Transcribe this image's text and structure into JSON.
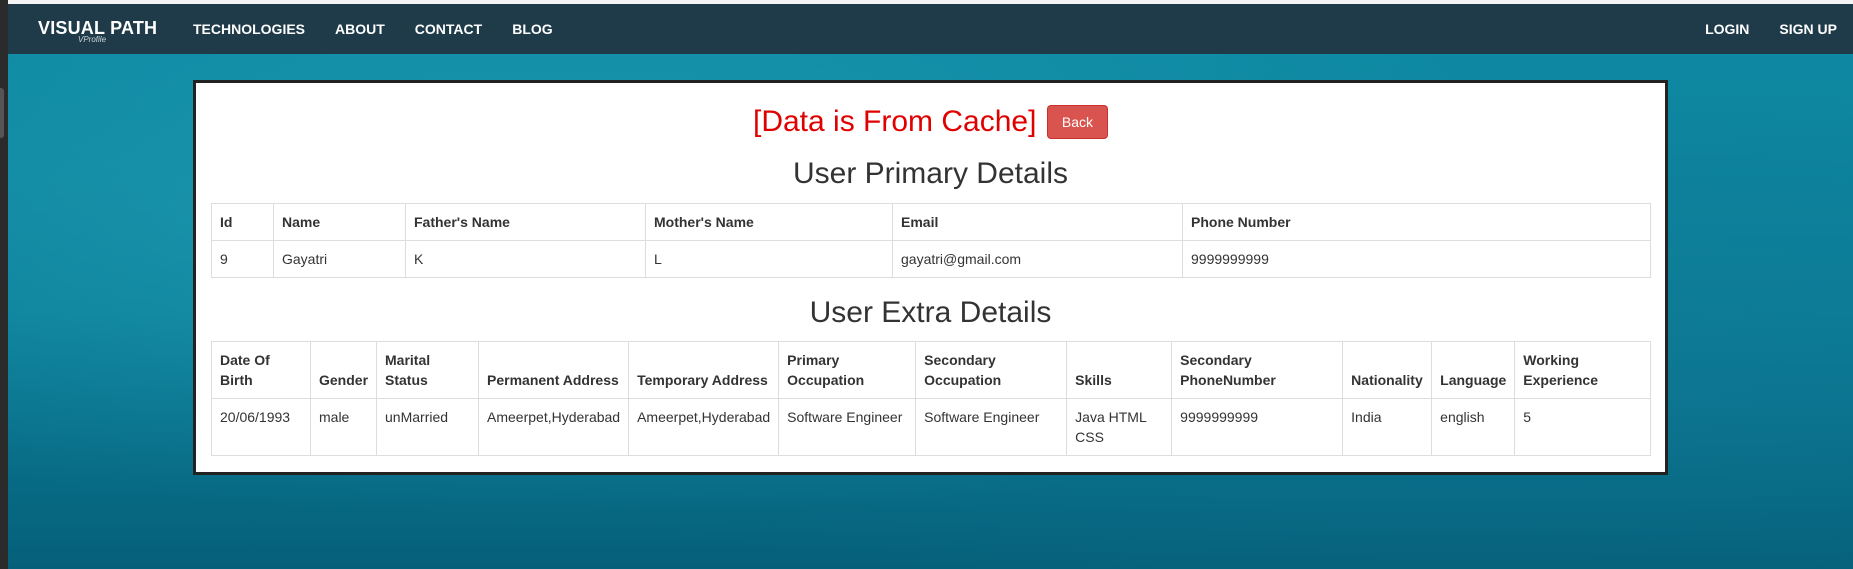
{
  "nav": {
    "brand": "VISUAL PATH",
    "brand_sub": "VProfile",
    "left_items": [
      "TECHNOLOGIES",
      "ABOUT",
      "CONTACT",
      "BLOG"
    ],
    "right_items": [
      "LOGIN",
      "SIGN UP"
    ]
  },
  "main": {
    "cache_notice": "[Data is From Cache]",
    "back_label": "Back",
    "primary": {
      "heading": "User Primary Details",
      "columns": [
        "Id",
        "Name",
        "Father's Name",
        "Mother's Name",
        "Email",
        "Phone Number"
      ],
      "rows": [
        [
          "9",
          "Gayatri",
          "K",
          "L",
          "gayatri@gmail.com",
          "9999999999"
        ]
      ]
    },
    "extra": {
      "heading": "User Extra Details",
      "columns": [
        "Date Of Birth",
        "Gender",
        "Marital Status",
        "Permanent Address",
        "Temporary Address",
        "Primary Occupation",
        "Secondary Occupation",
        "Skills",
        "Secondary PhoneNumber",
        "Nationality",
        "Language",
        "Working Experience"
      ],
      "rows": [
        [
          "20/06/1993",
          "male",
          "unMarried",
          "Ameerpet,Hyderabad",
          "Ameerpet,Hyderabad",
          "Software Engineer",
          "Software Engineer",
          "Java HTML CSS",
          "9999999999",
          "India",
          "english",
          "5"
        ]
      ]
    }
  },
  "colors": {
    "navbar": "#1f3a48",
    "alert_text": "#e00000",
    "back_button": "#d9534f",
    "background": "#0a7d97"
  }
}
